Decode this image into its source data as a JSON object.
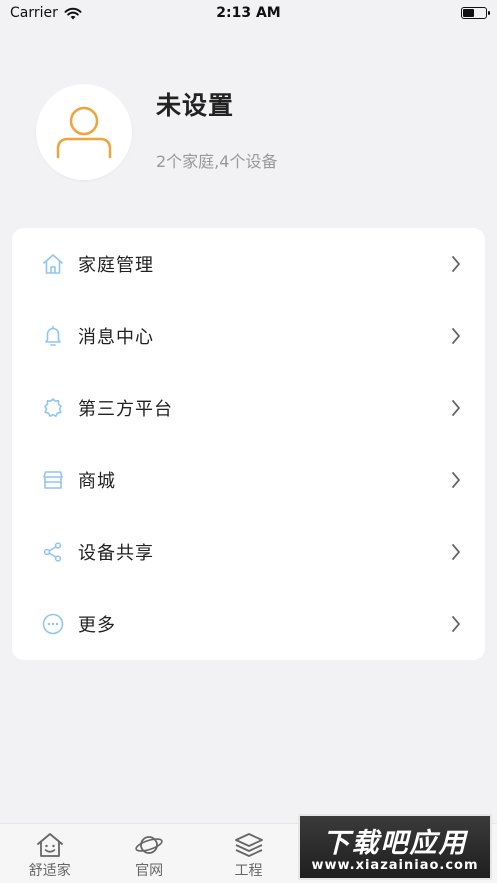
{
  "status_bar": {
    "carrier": "Carrier",
    "time": "2:13 AM",
    "battery_level": 0.5
  },
  "profile": {
    "name": "未设置",
    "subtitle": "2个家庭,4个设备"
  },
  "menu": {
    "items": [
      {
        "label": "家庭管理",
        "icon": "home-icon"
      },
      {
        "label": "消息中心",
        "icon": "bell-icon"
      },
      {
        "label": "第三方平台",
        "icon": "gear-icon"
      },
      {
        "label": "商城",
        "icon": "store-icon"
      },
      {
        "label": "设备共享",
        "icon": "share-icon"
      },
      {
        "label": "更多",
        "icon": "more-icon"
      }
    ]
  },
  "tabbar": {
    "tabs": [
      {
        "label": "舒适家",
        "icon": "smile-house-icon"
      },
      {
        "label": "官网",
        "icon": "planet-icon"
      },
      {
        "label": "工程",
        "icon": "layers-icon"
      }
    ]
  },
  "watermark": {
    "main": "下载吧应用",
    "url": "www.xiazainiao.com"
  },
  "colors": {
    "accent_icon": "#8fc6f0",
    "avatar_stroke": "#f0a33a",
    "background": "#f2f2f4"
  }
}
